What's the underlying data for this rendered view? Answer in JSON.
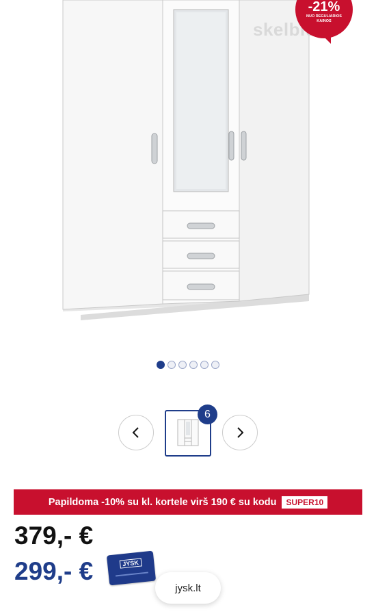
{
  "hero": {
    "watermark": "skelbiu.lt",
    "badge": {
      "percent": "-21%",
      "subtext": "NUO REGULIARIOS KAINOS"
    }
  },
  "carousel": {
    "total_dots": 6,
    "active_index": 0,
    "thumbnail_count": "6",
    "prev_icon": "chevron-left-icon",
    "next_icon": "chevron-right-icon"
  },
  "promo": {
    "text": "Papildoma -10% su kl. kortele virš 190 € su kodu",
    "code": "SUPER10"
  },
  "prices": {
    "old": "379,-  €",
    "new": "299,- €"
  },
  "card": {
    "logo": "JYSK"
  },
  "source_pill": "jysk.lt",
  "colors": {
    "brand_blue": "#1f3d8a",
    "promo_red": "#c8102e"
  }
}
